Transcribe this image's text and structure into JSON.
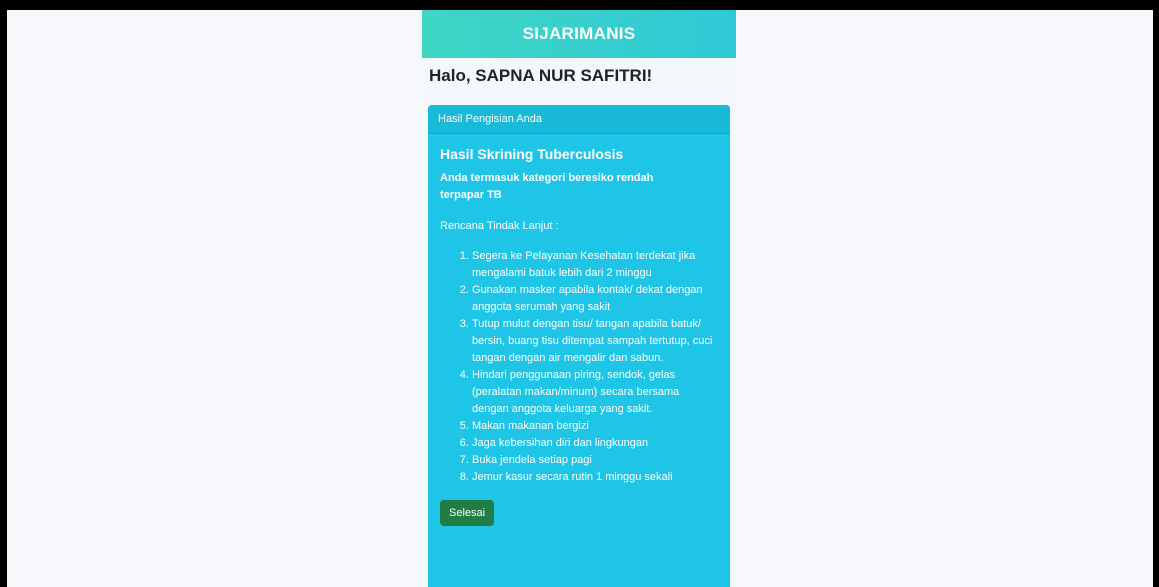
{
  "app": {
    "title": "SIJARIMANIS"
  },
  "greeting": "Halo, SAPNA NUR SAFITRI!",
  "card": {
    "header": "Hasil Pengisian Anda",
    "result_title": "Hasil Skrining Tuberculosis",
    "result_text": "Anda termasuk kategori beresiko rendah terpapar TB",
    "plan_label": "Rencana Tindak Lanjut :",
    "steps": [
      "Segera ke Pelayanan Kesehatan terdekat jika mengalami batuk lebih dari 2 minggu",
      "Gunakan masker apabila kontak/ dekat dengan anggota serumah yang sakit",
      "Tutup mulut dengan tisu/ tangan apabila batuk/ bersin, buang tisu ditempat sampah tertutup, cuci tangan dengan air mengalir dan sabun.",
      "Hindari penggunaan piring, sendok, gelas (peralatan makan/minum) secara bersama dengan anggota keluarga yang sakit.",
      "Makan makanan bergizi",
      "Jaga kebersihan diri dan lingkungan",
      "Buka jendela setiap pagi",
      "Jemur kasur secara rutin 1 minggu sekali"
    ],
    "done_label": "Selesai"
  },
  "colors": {
    "header_gradient_start": "#3fd6c3",
    "card_bg": "#1fc5e6",
    "button_bg": "#1f7d45"
  }
}
